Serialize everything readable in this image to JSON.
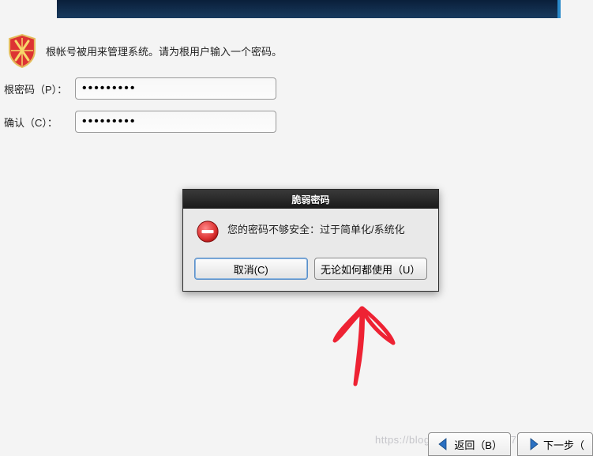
{
  "prompt": "根帐号被用来管理系统。请为根用户输入一个密码。",
  "labels": {
    "password": "根密码（P）：",
    "confirm": "确认（C）："
  },
  "inputs": {
    "password": "•••••••••",
    "confirm": "•••••••••"
  },
  "dialog": {
    "title": "脆弱密码",
    "message": "您的密码不够安全：过于简单化/系统化",
    "cancel": "取消(C)",
    "use_anyway": "无论如何都使用（U）"
  },
  "nav": {
    "back": "返回（B）",
    "next": "下一步（"
  },
  "watermark": "https://blog.csdn.net/Deng872347348",
  "colors": {
    "accent": "#2a89c9",
    "danger": "#d33"
  }
}
